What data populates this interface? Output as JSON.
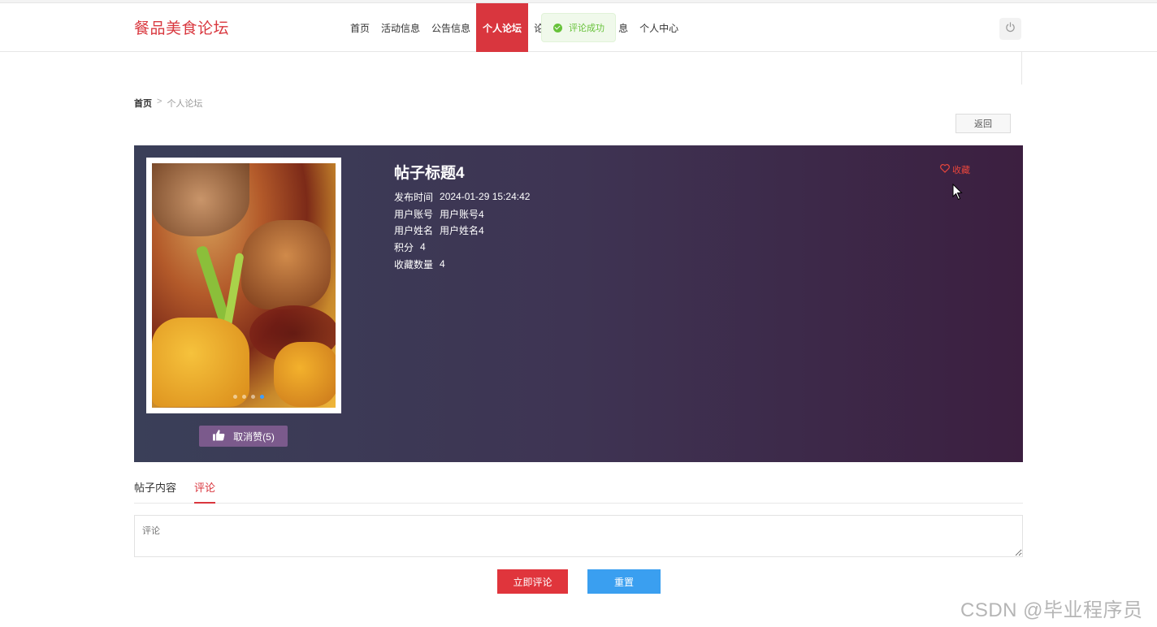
{
  "header": {
    "brand": "餐品美食论坛",
    "nav": [
      {
        "label": "首页",
        "active": false
      },
      {
        "label": "活动信息",
        "active": false
      },
      {
        "label": "公告信息",
        "active": false
      },
      {
        "label": "个人论坛",
        "active": true
      },
      {
        "label": "论",
        "active": false
      },
      {
        "label": "息",
        "active": false
      },
      {
        "label": "个人中心",
        "active": false
      }
    ],
    "power_icon": "power-icon"
  },
  "toast": {
    "text": "评论成功",
    "icon": "check-circle-icon"
  },
  "breadcrumb": {
    "home": "首页",
    "sep": ">",
    "current": "个人论坛"
  },
  "back_button": "返回",
  "post": {
    "title": "帖子标题4",
    "favorite_label": "收藏",
    "favorite_icon": "heart-icon",
    "like_button": "取消赞(5)",
    "like_icon": "thumbs-up-icon",
    "info": [
      {
        "label": "发布时间",
        "value": "2024-01-29 15:24:42"
      },
      {
        "label": "用户账号",
        "value": "用户账号4"
      },
      {
        "label": "用户姓名",
        "value": "用户姓名4"
      },
      {
        "label": "积分",
        "value": "4"
      },
      {
        "label": "收藏数量",
        "value": "4"
      }
    ]
  },
  "tabs": [
    {
      "label": "帖子内容",
      "active": false
    },
    {
      "label": "评论",
      "active": true
    }
  ],
  "comment": {
    "placeholder": "评论",
    "value": ""
  },
  "buttons": {
    "submit": "立即评论",
    "reset": "重置"
  },
  "watermark": "CSDN @毕业程序员",
  "colors": {
    "accent": "#d9363e",
    "reset": "#3a9ff0",
    "success": "#67c23a"
  }
}
